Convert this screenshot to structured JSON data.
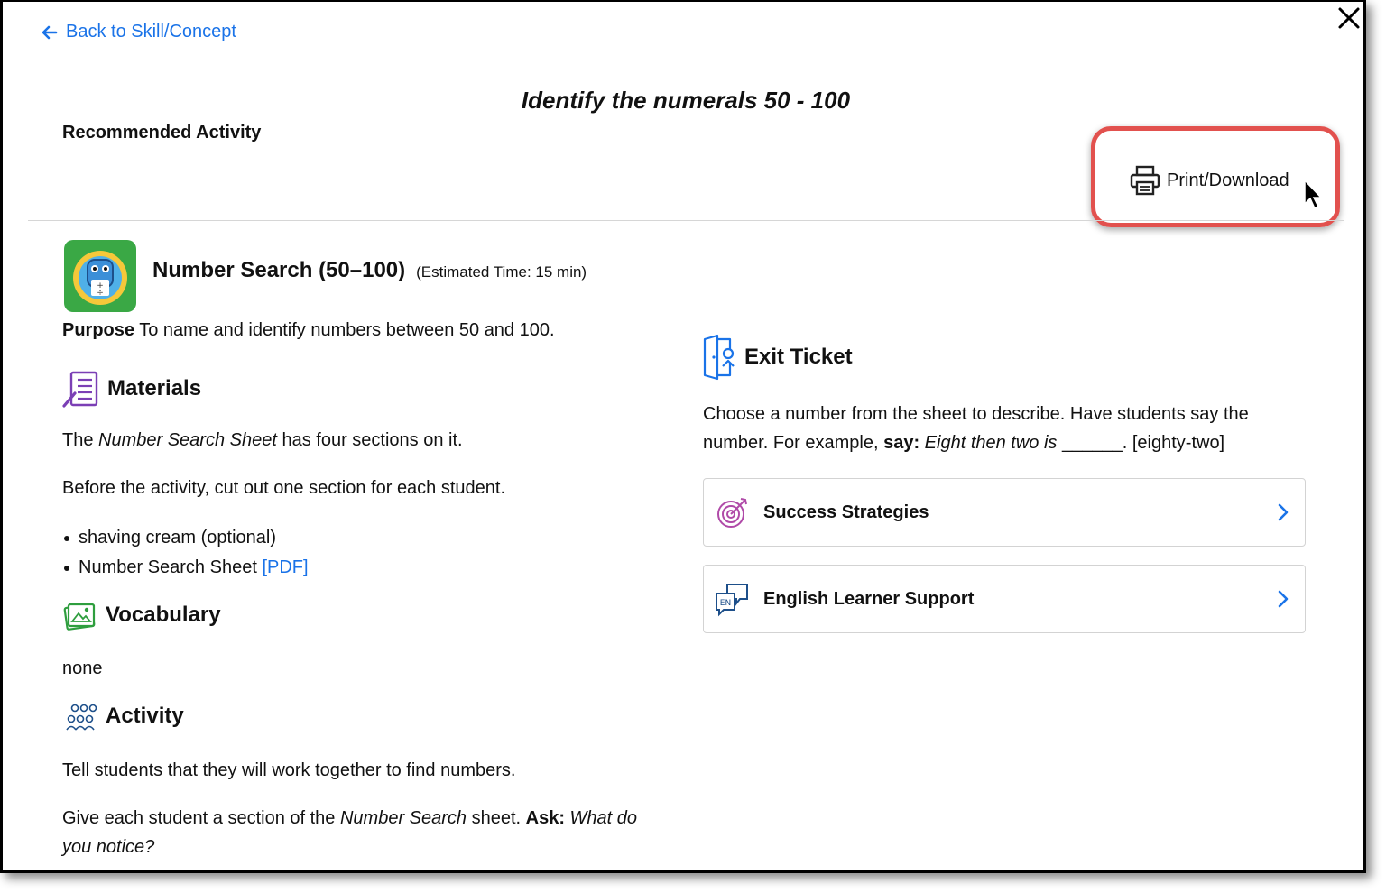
{
  "nav": {
    "back_label": "Back to Skill/Concept"
  },
  "header": {
    "title": "Identify the numerals 50 - 100",
    "subtitle": "Recommended Activity",
    "print_label": "Print/Download"
  },
  "activity": {
    "name": "Number Search (50–100)",
    "time": "(Estimated Time: 15 min)",
    "purpose_label": "Purpose",
    "purpose_text": " To name and identify numbers between 50 and 100."
  },
  "materials": {
    "heading": "Materials",
    "p1_pre": "The ",
    "p1_em": "Number Search Sheet",
    "p1_post": " has four sections on it.",
    "p2": "Before the activity, cut out one section for each student.",
    "items": [
      "shaving cream (optional)",
      "Number Search Sheet "
    ],
    "pdf_label": "[PDF]"
  },
  "vocabulary": {
    "heading": "Vocabulary",
    "text": "none"
  },
  "activity_section": {
    "heading": "Activity",
    "p1": "Tell students that they will work together to find numbers.",
    "p2_pre": "Give each student a section of the ",
    "p2_em": "Number Search",
    "p2_mid": " sheet. ",
    "p2_ask": "Ask:",
    "p2_q1": " What do",
    "p2_q2": "you notice?"
  },
  "exit_ticket": {
    "heading": "Exit Ticket",
    "line1": "Choose a number from the sheet to describe. Have students say the",
    "line2_pre": "number. For example, ",
    "line2_say": "say:",
    "line2_em": " Eight then two is ",
    "line2_post": "______. [eighty-two]"
  },
  "accordions": [
    {
      "label": "Success Strategies",
      "icon": "target-icon"
    },
    {
      "label": "English Learner Support",
      "icon": "speech-bubbles-en-icon"
    }
  ],
  "colors": {
    "link": "#1a73e8",
    "highlight": "#e2514e",
    "purple_icon": "#7b3fb5",
    "green_icon": "#2e9e3e",
    "blue_icon": "#1a73e8"
  }
}
